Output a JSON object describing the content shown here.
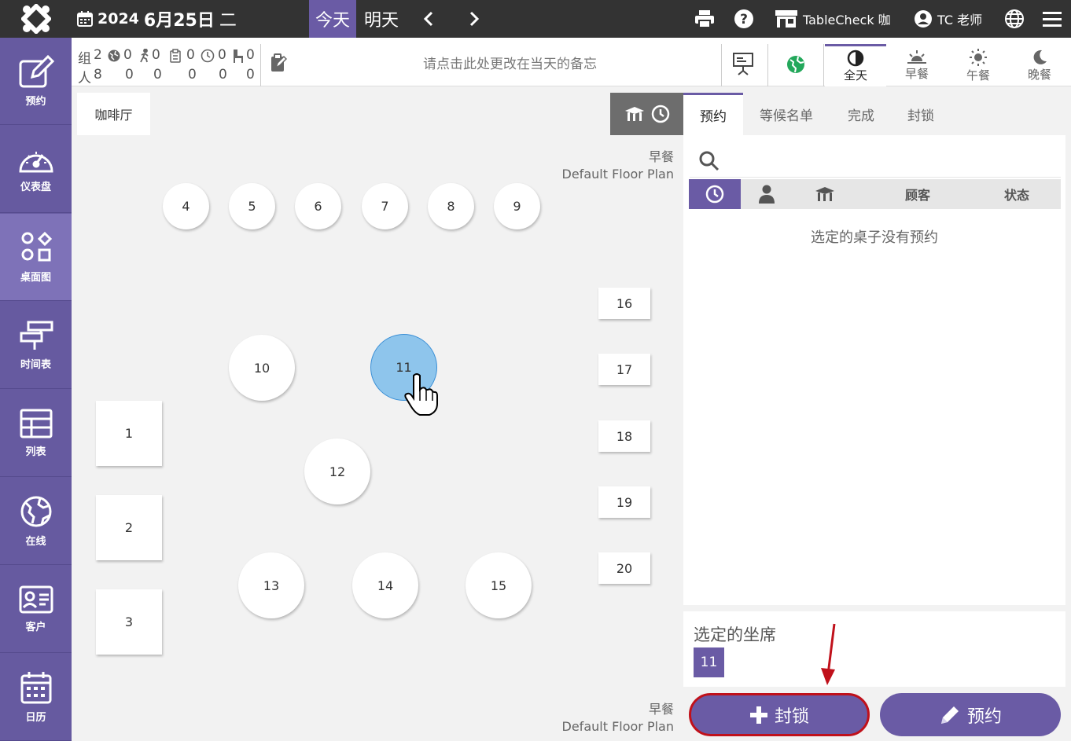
{
  "header": {
    "year": "2024",
    "date": "6月25日",
    "weekday": "二",
    "today_label": "今天",
    "tomorrow_label": "明天",
    "restaurant": "TableCheck 咖",
    "user": "TC 老师",
    "icons": [
      "logo-icon",
      "calendar-icon",
      "chevron-left-icon",
      "chevron-right-icon",
      "printer-icon",
      "help-icon",
      "store-icon",
      "user-icon",
      "globe-icon",
      "menu-icon"
    ]
  },
  "sidebar": {
    "items": [
      {
        "label": "预约",
        "icon": "edit-icon"
      },
      {
        "label": "仪表盘",
        "icon": "gauge-icon"
      },
      {
        "label": "桌面图",
        "icon": "floorplan-icon"
      },
      {
        "label": "时间表",
        "icon": "timeline-icon"
      },
      {
        "label": "列表",
        "icon": "table-icon"
      },
      {
        "label": "在线",
        "icon": "globe-icon"
      },
      {
        "label": "客户",
        "icon": "customer-card-icon"
      },
      {
        "label": "日历",
        "icon": "calendar-icon"
      }
    ]
  },
  "stats": {
    "group_label": "组",
    "people_label": "人",
    "groups": [
      "2",
      "0",
      "0",
      "0",
      "0",
      "0"
    ],
    "people": [
      "8",
      "0",
      "0",
      "0",
      "0",
      "0"
    ]
  },
  "memo": {
    "placeholder": "请点击此处更改在当天的备忘"
  },
  "periods": [
    {
      "label": "全天",
      "icon": "half-circle-icon"
    },
    {
      "label": "早餐",
      "icon": "sunrise-icon"
    },
    {
      "label": "午餐",
      "icon": "sun-icon"
    },
    {
      "label": "晚餐",
      "icon": "moon-icon"
    }
  ],
  "floor": {
    "tab": "咖啡厅",
    "plan_period_top": "早餐",
    "plan_name_top": "Default Floor Plan",
    "plan_period_bottom": "早餐",
    "plan_name_bottom": "Default Floor Plan",
    "tables": [
      "1",
      "2",
      "3",
      "4",
      "5",
      "6",
      "7",
      "8",
      "9",
      "10",
      "11",
      "12",
      "13",
      "14",
      "15",
      "16",
      "17",
      "18",
      "19",
      "20"
    ],
    "selected_table": "11"
  },
  "right": {
    "tabs": [
      "预约",
      "等候名单",
      "完成",
      "封锁"
    ],
    "columns": [
      "顾客",
      "状态"
    ],
    "empty_message": "选定的桌子没有预约",
    "selected_seats_title": "选定的坐席",
    "selected_seat": "11",
    "block_button": "封锁",
    "reserve_button": "预约"
  },
  "colors": {
    "accent": "#6a5ba5",
    "topbar": "#333333",
    "selected_table": "#8ec5ec",
    "highlight": "#c0111b"
  }
}
